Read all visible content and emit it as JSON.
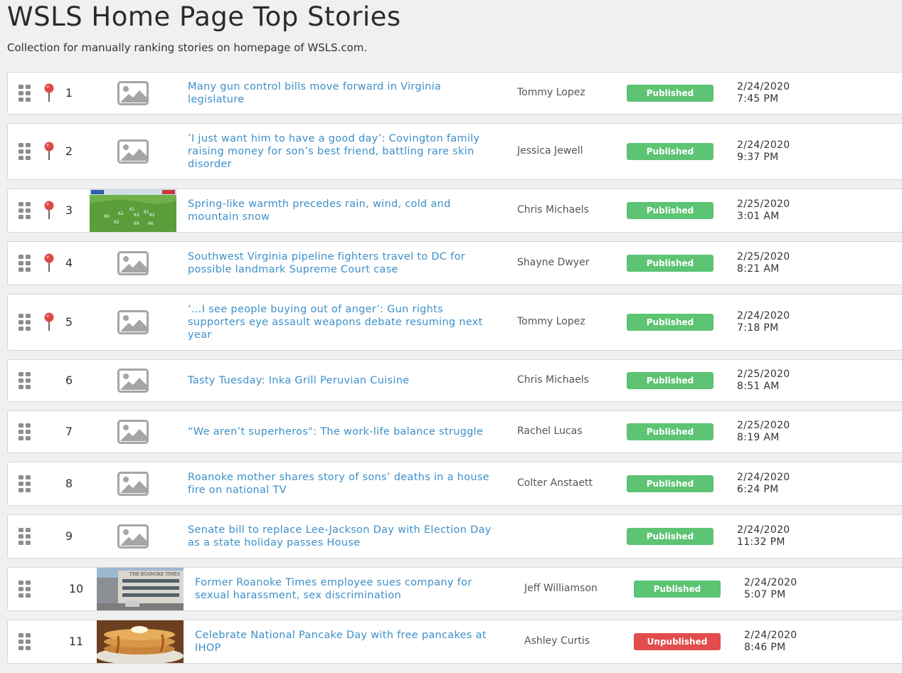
{
  "header": {
    "title": "WSLS Home Page Top Stories",
    "subtitle": "Collection for manually ranking stories on homepage of WSLS.com."
  },
  "colors": {
    "link": "#3d8fc9",
    "published": "#5cc472",
    "unpublished": "#e24c4c",
    "pin": "#e04848",
    "handle": "#8c8c8c"
  },
  "stories": [
    {
      "rank": "1",
      "pinned": true,
      "thumb": "placeholder",
      "headline": "Many gun control bills move forward in Virginia legislature",
      "author": "Tommy Lopez",
      "status": "Published",
      "date": "2/24/2020",
      "time": "7:45 PM"
    },
    {
      "rank": "2",
      "pinned": true,
      "thumb": "placeholder",
      "headline": "’I just want him to have a good day’: Covington family raising money for son’s best friend, battling rare skin disorder",
      "author": "Jessica Jewell",
      "status": "Published",
      "date": "2/24/2020",
      "time": "9:37 PM"
    },
    {
      "rank": "3",
      "pinned": true,
      "thumb": "weather-map",
      "headline": "Spring-like warmth precedes rain, wind, cold and mountain snow",
      "author": "Chris Michaels",
      "status": "Published",
      "date": "2/25/2020",
      "time": "3:01 AM"
    },
    {
      "rank": "4",
      "pinned": true,
      "thumb": "placeholder",
      "headline": "Southwest Virginia pipeline fighters travel to DC for possible landmark Supreme Court case",
      "author": "Shayne Dwyer",
      "status": "Published",
      "date": "2/25/2020",
      "time": "8:21 AM"
    },
    {
      "rank": "5",
      "pinned": true,
      "thumb": "placeholder",
      "headline": "‘…I see people buying out of anger’: Gun rights supporters eye assault weapons debate resuming next year",
      "author": "Tommy Lopez",
      "status": "Published",
      "date": "2/24/2020",
      "time": "7:18 PM"
    },
    {
      "rank": "6",
      "pinned": false,
      "thumb": "placeholder",
      "headline": "Tasty Tuesday: Inka Grill Peruvian Cuisine",
      "author": "Chris Michaels",
      "status": "Published",
      "date": "2/25/2020",
      "time": "8:51 AM"
    },
    {
      "rank": "7",
      "pinned": false,
      "thumb": "placeholder",
      "headline": "“We aren’t superheros\": The work-life balance struggle",
      "author": "Rachel Lucas",
      "status": "Published",
      "date": "2/25/2020",
      "time": "8:19 AM"
    },
    {
      "rank": "8",
      "pinned": false,
      "thumb": "placeholder",
      "headline": "Roanoke mother shares story of sons’ deaths in a house fire on national TV",
      "author": "Colter Anstaett",
      "status": "Published",
      "date": "2/24/2020",
      "time": "6:24 PM"
    },
    {
      "rank": "9",
      "pinned": false,
      "thumb": "placeholder",
      "headline": "Senate bill to replace Lee-Jackson Day with Election Day as a state holiday passes House",
      "author": "",
      "status": "Published",
      "date": "2/24/2020",
      "time": "11:32 PM"
    },
    {
      "rank": "10",
      "pinned": false,
      "thumb": "building",
      "headline": "Former Roanoke Times employee sues company for sexual harassment, sex discrimination",
      "author": "Jeff Williamson",
      "status": "Published",
      "date": "2/24/2020",
      "time": "5:07 PM"
    },
    {
      "rank": "11",
      "pinned": false,
      "thumb": "pancakes",
      "headline": "Celebrate National Pancake Day with free pancakes at IHOP",
      "author": "Ashley Curtis",
      "status": "Unpublished",
      "date": "2/24/2020",
      "time": "8:46 PM"
    }
  ]
}
